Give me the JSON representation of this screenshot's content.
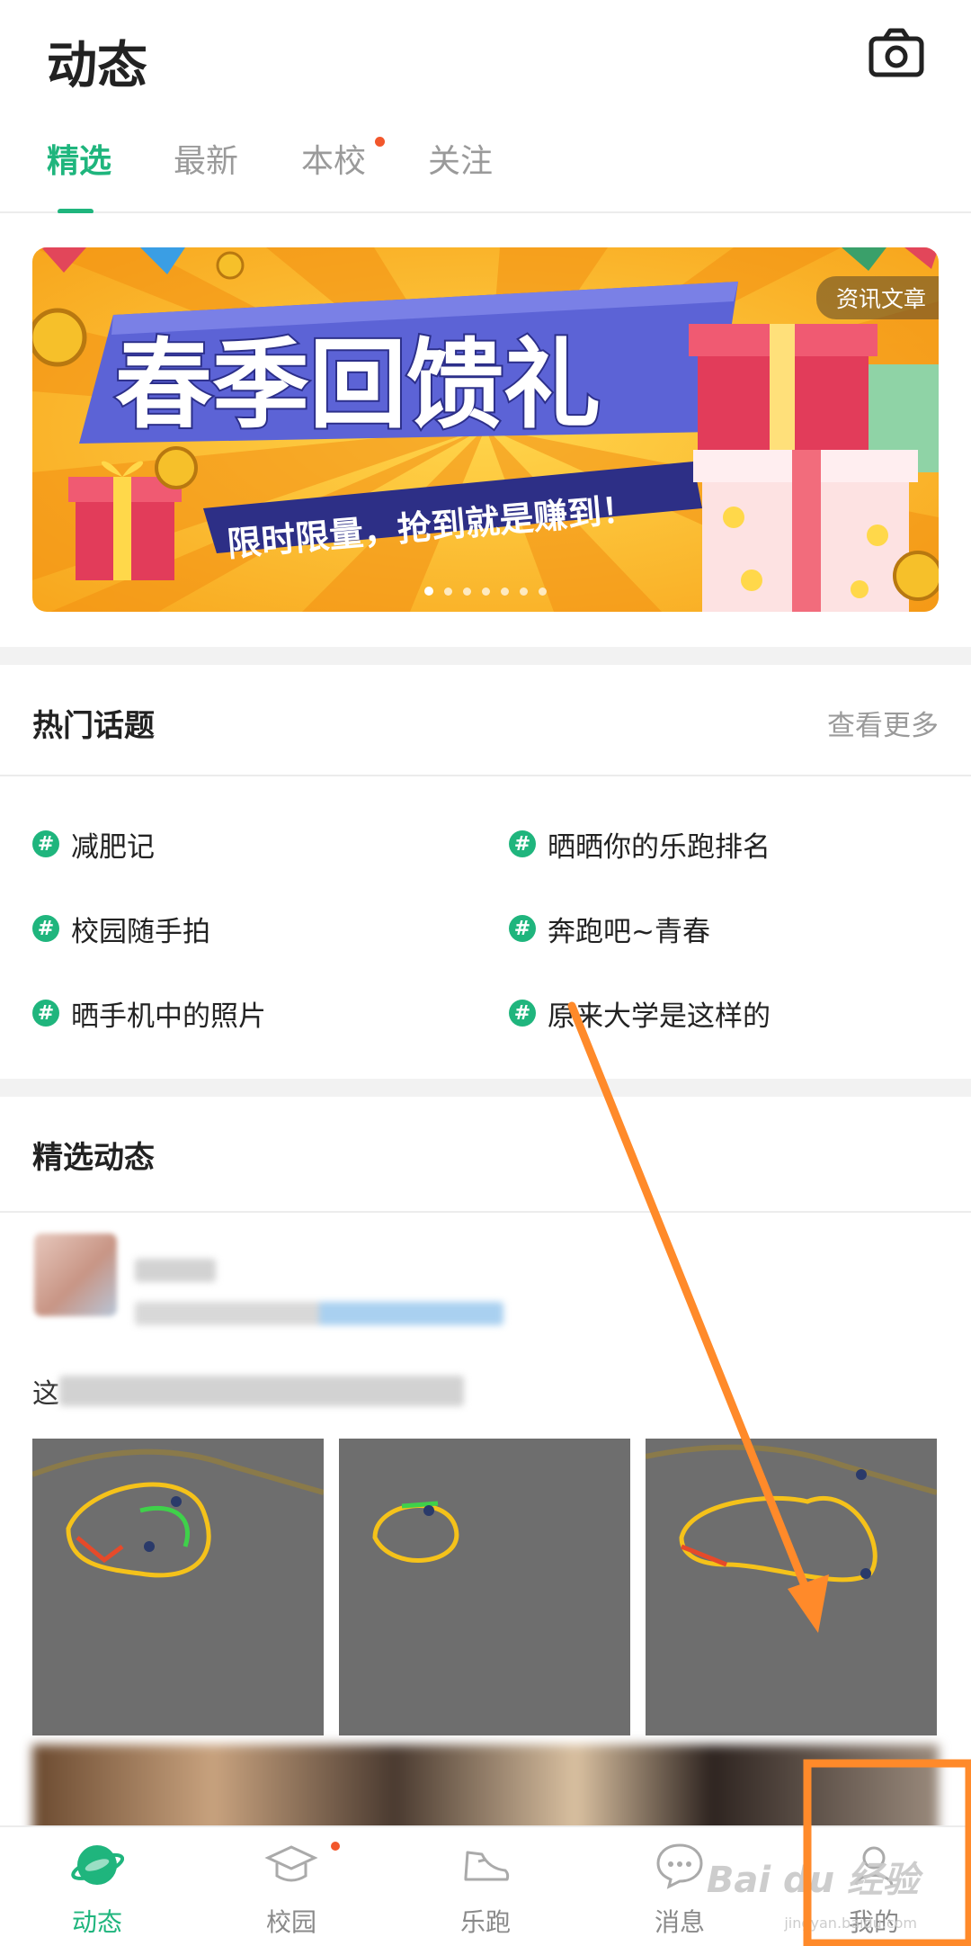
{
  "header": {
    "title": "动态",
    "tabs": [
      {
        "label": "精选",
        "active": true
      },
      {
        "label": "最新",
        "active": false
      },
      {
        "label": "本校",
        "active": false,
        "badge": true
      },
      {
        "label": "关注",
        "active": false
      }
    ]
  },
  "banner": {
    "headline": "春季回馈礼",
    "subline": "限时限量，抢到就是赚到！",
    "tag": "资讯文章",
    "page_count": 7,
    "active_index": 0
  },
  "hot_topics": {
    "title": "热门话题",
    "more": "查看更多",
    "items": [
      "减肥记",
      "晒晒你的乐跑排名",
      "校园随手拍",
      "奔跑吧~青春",
      "晒手机中的照片",
      "原来大学是这样的"
    ]
  },
  "featured": {
    "title": "精选动态",
    "post_text": "这"
  },
  "tabbar": {
    "items": [
      {
        "label": "动态",
        "icon": "planet-icon",
        "active": true
      },
      {
        "label": "校园",
        "icon": "graduation-cap-icon",
        "active": false
      },
      {
        "label": "乐跑",
        "icon": "shoe-icon",
        "active": false
      },
      {
        "label": "消息",
        "icon": "chat-bubble-icon",
        "active": false
      },
      {
        "label": "我的",
        "icon": "person-icon",
        "active": false
      }
    ]
  },
  "watermark": {
    "brand": "Bai du 经验",
    "url": "jingyan.baidu.com"
  },
  "colors": {
    "accent": "#1fb57d",
    "badge": "#f2572c",
    "annotation": "#ff8a2a"
  }
}
